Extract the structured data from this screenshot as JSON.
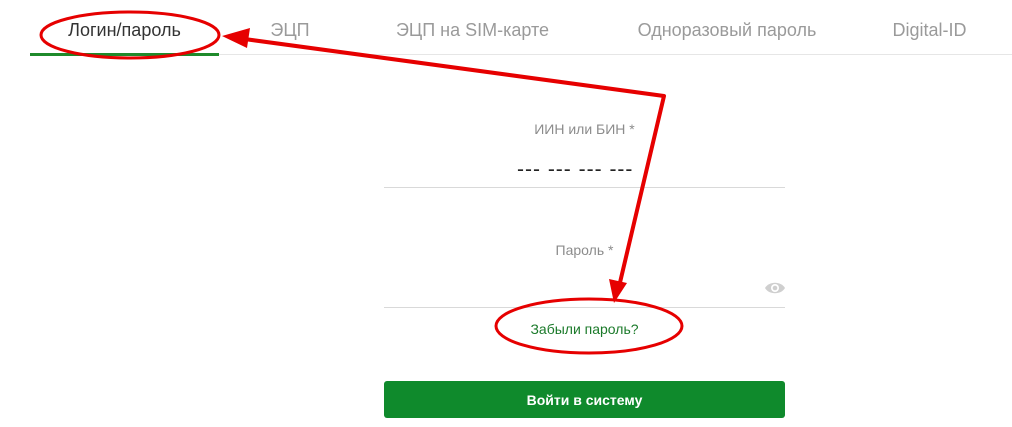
{
  "tabs": [
    {
      "label": "Логин/пароль",
      "active": true
    },
    {
      "label": "ЭЦП",
      "active": false
    },
    {
      "label": "ЭЦП на SIM-карте",
      "active": false
    },
    {
      "label": "Одноразовый пароль",
      "active": false
    },
    {
      "label": "Digital-ID",
      "active": false
    }
  ],
  "form": {
    "iin_label": "ИИН или БИН *",
    "iin_mask": "--- --- --- ---",
    "password_label": "Пароль *",
    "show_password_icon": "eye-icon",
    "forgot_link": "Забыли пароль?",
    "submit_label": "Войти в систему"
  },
  "colors": {
    "accent_green": "#0f8a2c",
    "tab_active_underline": "#1f8a2b",
    "annotation_red": "#e60000"
  }
}
